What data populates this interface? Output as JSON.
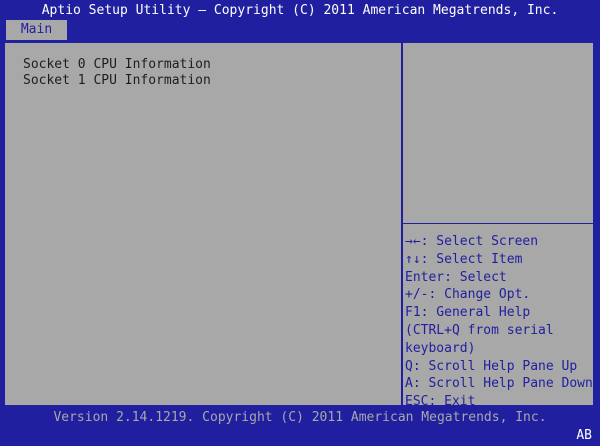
{
  "header": {
    "title": "Aptio Setup Utility – Copyright (C) 2011 American Megatrends, Inc."
  },
  "tabs": [
    {
      "label": "Main",
      "selected": true
    }
  ],
  "menu": {
    "items": [
      {
        "label": "Socket 0 CPU Information"
      },
      {
        "label": "Socket 1 CPU Information"
      }
    ]
  },
  "help": {
    "keys": [
      "→←: Select Screen",
      "↑↓: Select Item",
      "Enter: Select",
      "+/-: Change Opt.",
      "F1: General Help",
      "(CTRL+Q from serial",
      "keyboard)",
      "Q: Scroll Help Pane Up",
      "A: Scroll Help Pane Down",
      "ESC: Exit"
    ]
  },
  "footer": {
    "version": "Version 2.14.1219. Copyright (C) 2011 American Megatrends, Inc.",
    "badge": "AB"
  },
  "colors": {
    "background": "#1f1f9f",
    "panel": "#a8a8a8",
    "text_dark": "#1e1e1e",
    "highlight_text": "#ffffff"
  }
}
